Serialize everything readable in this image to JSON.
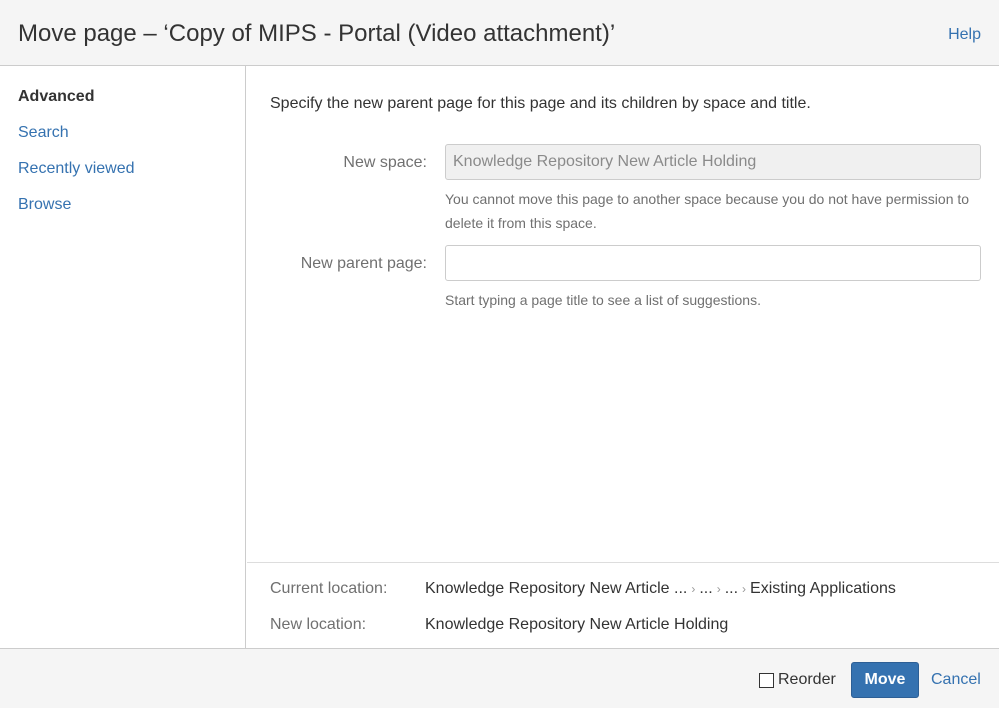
{
  "dialog": {
    "title": "Move page – ‘Copy of MIPS - Portal (Video attachment)’",
    "help_label": "Help"
  },
  "sidebar": {
    "items": [
      {
        "label": "Advanced",
        "active": true
      },
      {
        "label": "Search",
        "active": false
      },
      {
        "label": "Recently viewed",
        "active": false
      },
      {
        "label": "Browse",
        "active": false
      }
    ]
  },
  "main": {
    "intro": "Specify the new parent page for this page and its children by space and title.",
    "new_space": {
      "label": "New space:",
      "value": "Knowledge Repository New Article Holding",
      "help": "You cannot move this page to another space because you do not have permission to delete it from this space."
    },
    "new_parent": {
      "label": "New parent page:",
      "value": "",
      "help": "Start typing a page title to see a list of suggestions."
    }
  },
  "locations": {
    "current_label": "Current location:",
    "current_crumbs": [
      "Knowledge Repository New Article ...",
      "...",
      "...",
      "Existing Applications"
    ],
    "new_label": "New location:",
    "new_value": "Knowledge Repository New Article Holding"
  },
  "footer": {
    "reorder_label": "Reorder",
    "reorder_checked": false,
    "move_label": "Move",
    "cancel_label": "Cancel"
  },
  "colors": {
    "accent": "#3572b0",
    "header_bg": "#f5f5f5"
  }
}
